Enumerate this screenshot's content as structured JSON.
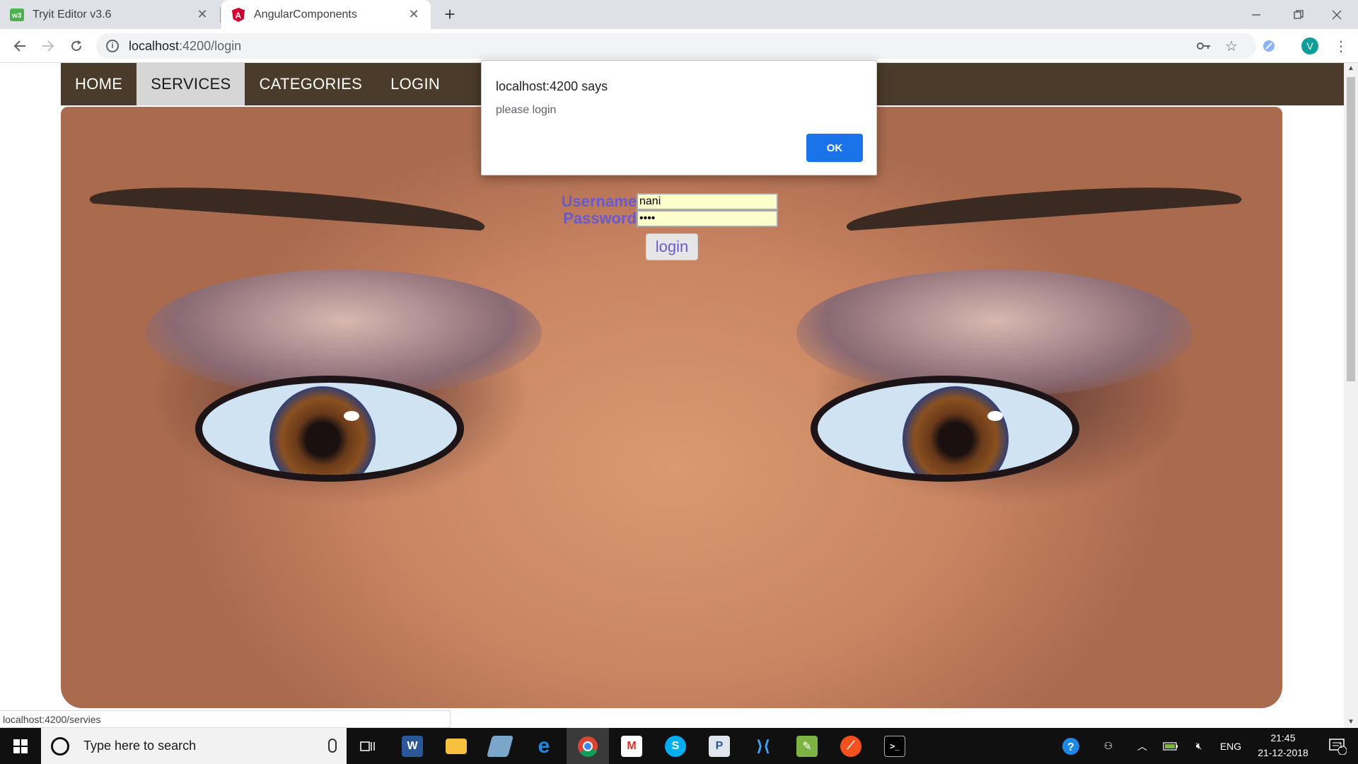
{
  "browser": {
    "tabs": [
      {
        "title": "Tryit Editor v3.6",
        "icon": "w3-icon",
        "active": false
      },
      {
        "title": "AngularComponents",
        "icon": "angular-icon",
        "active": true
      }
    ],
    "new_tab_label": "+",
    "address": {
      "host": "localhost",
      "path": ":4200/login"
    },
    "profile_initial": "V",
    "status_url": "localhost:4200/servies"
  },
  "site": {
    "nav": [
      "HOME",
      "SERVICES",
      "CATEGORIES",
      "LOGIN"
    ],
    "active_nav": "SERVICES",
    "form": {
      "username_label": "Username",
      "username_value": "nani",
      "password_label": "Password",
      "password_value": "••••",
      "submit_label": "login"
    },
    "colors": {
      "navbar": "#4a3b2a",
      "label": "#6a5acd",
      "input_bg": "#ffffcc"
    }
  },
  "alert": {
    "title": "localhost:4200 says",
    "message": "please login",
    "ok_label": "OK",
    "ok_color": "#1a73e8"
  },
  "taskbar": {
    "search_placeholder": "Type here to search",
    "language": "ENG",
    "time": "21:45",
    "date": "21-12-2018",
    "notification_count": "1"
  }
}
